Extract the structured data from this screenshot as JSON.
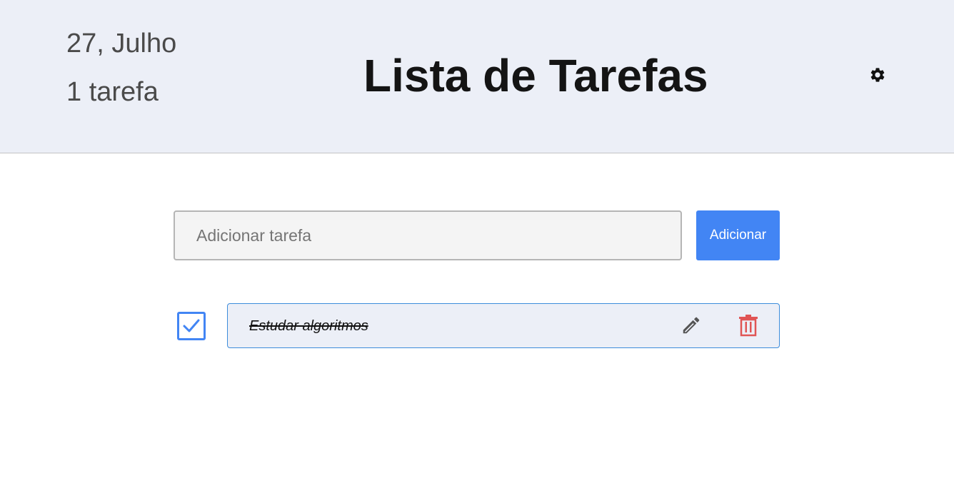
{
  "header": {
    "date": "27, Julho",
    "task_count": "1 tarefa",
    "title": "Lista de Tarefas",
    "settings_icon": "gear-icon"
  },
  "add_task": {
    "placeholder": "Adicionar tarefa",
    "value": "",
    "button_label": "Adicionar"
  },
  "tasks": [
    {
      "text": "Estudar algoritmos",
      "completed": true,
      "edit_icon": "pencil-icon",
      "delete_icon": "trash-icon"
    }
  ],
  "colors": {
    "header_bg": "#eceff7",
    "accent": "#4285f4",
    "delete": "#e05555",
    "task_border": "#3d8ddb"
  }
}
